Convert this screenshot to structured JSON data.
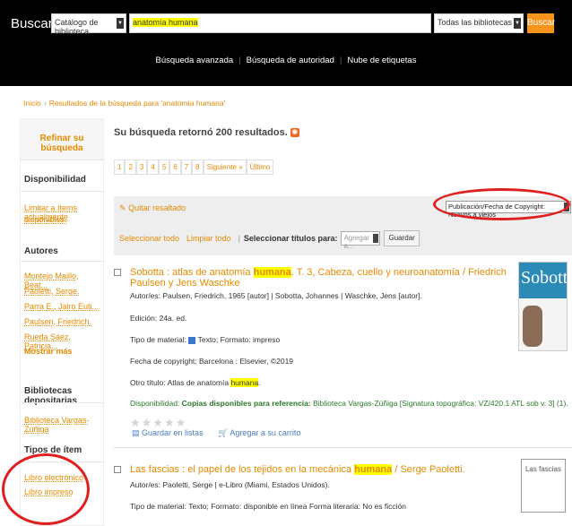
{
  "header": {
    "search_label": "Buscar",
    "catalog_select": "Catálogo de biblioteca",
    "query": "anatomía humana",
    "library_select": "Todas las bibliotecas",
    "search_button": "Buscar",
    "nav": [
      "Búsqueda avanzada",
      "Búsqueda de autoridad",
      "Nube de etiquetas"
    ]
  },
  "breadcrumb": {
    "home": "Inicio",
    "current": "Resultados de la búsqueda para 'anatomía humana'"
  },
  "sidebar": {
    "refine_title": "Refinar su búsqueda",
    "availability_title": "Disponibilidad",
    "availability_link_1": "Limitar a ítems actualmente",
    "availability_link_2": "disponibles.",
    "authors_title": "Autores",
    "authors": [
      "Montejo Maillo, Beat...",
      "Paoletti, Serge.",
      "Parra E., Jairo Euti...",
      "Paulsen, Friedrich.",
      "Rueda Sáez, Patricia..."
    ],
    "show_more": "Mostrar más",
    "libraries_title": "Bibliotecas depositarias",
    "library": "Biblioteca Vargas-Zúñiga",
    "item_types_title": "Tipos de ítem",
    "item_types": [
      "Libro electrónico",
      "Libro impreso"
    ]
  },
  "results": {
    "summary": "Su búsqueda retornó 200 resultados.",
    "pages": [
      "1",
      "2",
      "3",
      "4",
      "5",
      "6",
      "7",
      "8",
      "Siguiente »",
      "Último"
    ],
    "remove_highlight": "Quitar resaltado",
    "sort_value": "Publicación/Fecha de Copyright: Nuevos a viejos",
    "select_all": "Seleccionar todo",
    "clear_all": "Limpiar todo",
    "select_titles_label": "Seleccionar títulos para:",
    "add_to": "Agregar a...",
    "save": "Guardar"
  },
  "records": [
    {
      "title_pre": "Sobotta : atlas de anatomía ",
      "title_hl": "humana",
      "title_post": ". T. 3, Cabeza, cuello y neuroanatomía / Friedrich Paulsen y Jens Waschke",
      "authors": "Autor/es: Paulsen, Friedrich, 1965 [autor] | Sobotta, Johannes | Waschke, Jens [autor].",
      "edition": "Edición: 24a. ed.",
      "material_label": "Tipo de material:",
      "material_value": "Texto; Formato: impreso",
      "copyright": "Fecha de copyright: Barcelona : Elsevier, ©2019",
      "other_title_label": "Otro título: Atlas de anatomía ",
      "other_title_hl": "humana",
      "other_title_post": ".",
      "availability_label": "Disponibilidad: ",
      "availability_green": "Copias disponibles para referencia:",
      "availability_detail": " Biblioteca Vargas-Zúñiga [Signatura topográfica: VZ/420.1 ATL sob v. 3] (1).",
      "stars": "★★★★★",
      "save_to_list": "Guardar en listas",
      "add_to_cart": "Agregar a su carrito",
      "cover_title": "Sobotta"
    },
    {
      "title_pre": "Las fascias : el papel de los tejidos en la mecánica ",
      "title_hl": "humana",
      "title_post": " / Serge Paoletti.",
      "authors": "Autor/es: Paoletti, Serge | e-Libro (Miami, Estados Unidos).",
      "material_line": "Tipo de material:  Texto; Formato: disponible en línea  Forma literaria: No es ficción",
      "cover_title": "Las fascias"
    }
  ]
}
